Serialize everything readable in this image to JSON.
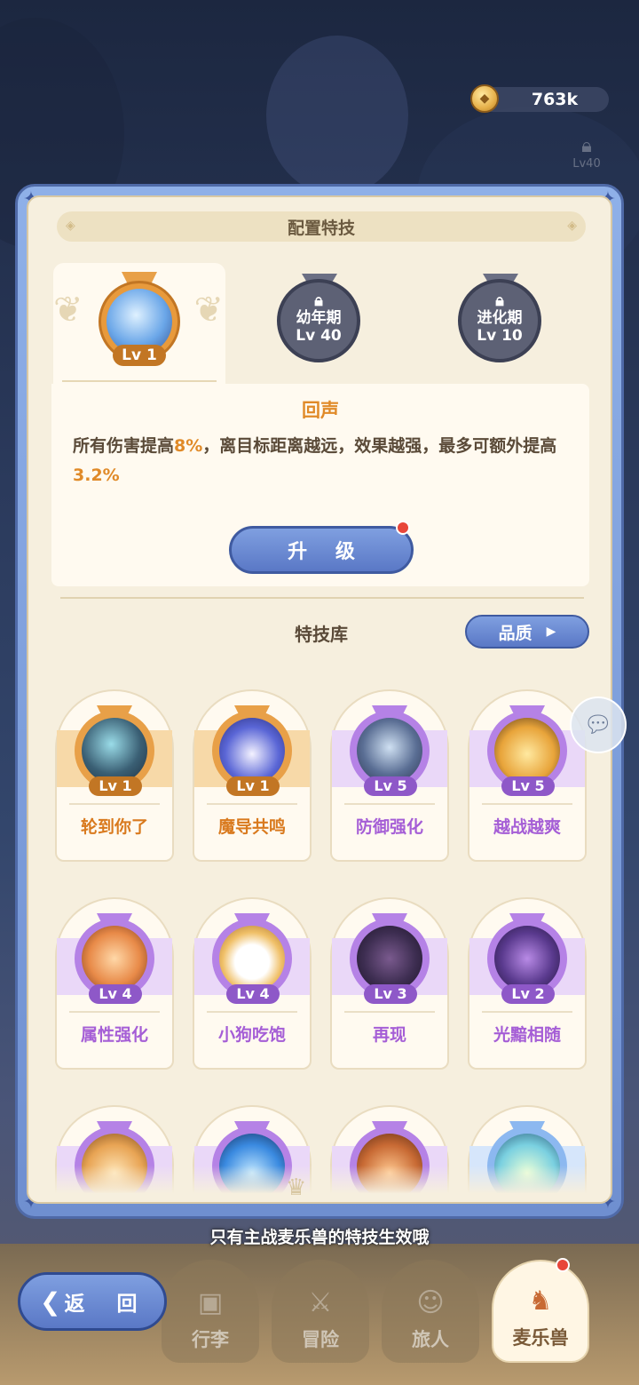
{
  "currency": {
    "amount": "763k",
    "icon": "coin-icon"
  },
  "side_lock": {
    "label": "Lv40"
  },
  "panel": {
    "title": "配置特技",
    "slots": [
      {
        "type": "active",
        "level": "Lv 1"
      },
      {
        "type": "locked",
        "line1": "幼年期",
        "line2": "Lv 40"
      },
      {
        "type": "locked",
        "line1": "进化期",
        "line2": "Lv 10"
      }
    ],
    "skill": {
      "name": "回声",
      "desc_a": "所有伤害提高",
      "desc_hl1": "8%",
      "desc_b": "，离目标距离越远，效果越强，最多可额外提高",
      "desc_hl2": "3.2%"
    },
    "upgrade_label": "升 级",
    "library_title": "特技库",
    "quality_label": "品质"
  },
  "cards": [
    {
      "name": "轮到你了",
      "level": "Lv 1",
      "tier": "orange"
    },
    {
      "name": "魔导共鸣",
      "level": "Lv 1",
      "tier": "orange"
    },
    {
      "name": "防御强化",
      "level": "Lv 5",
      "tier": "purple"
    },
    {
      "name": "越战越爽",
      "level": "Lv 5",
      "tier": "purple"
    },
    {
      "name": "属性强化",
      "level": "Lv 4",
      "tier": "purple"
    },
    {
      "name": "小狗吃饱",
      "level": "Lv 4",
      "tier": "purple"
    },
    {
      "name": "再现",
      "level": "Lv 3",
      "tier": "purple"
    },
    {
      "name": "光黯相随",
      "level": "Lv 2",
      "tier": "purple"
    }
  ],
  "hint": "只有主战麦乐兽的特技生效哦",
  "nav": {
    "back": "返 回",
    "tabs": [
      "行李",
      "冒险",
      "旅人",
      "麦乐兽"
    ]
  },
  "colors": {
    "accent_blue": "#5a78c6",
    "orange_text": "#e08a28",
    "purple_text": "#a55ed6",
    "badge_red": "#e8463a"
  }
}
